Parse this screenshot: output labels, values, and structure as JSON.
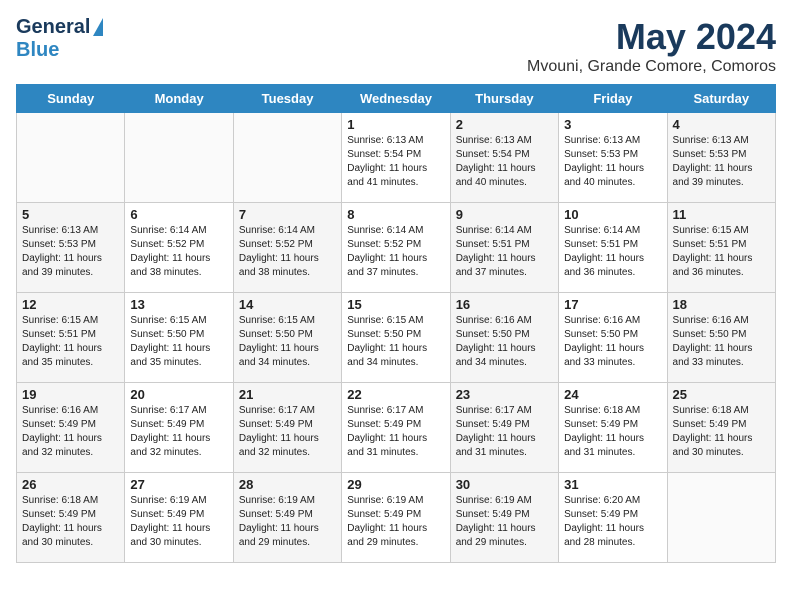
{
  "header": {
    "logo_line1": "General",
    "logo_line2": "Blue",
    "month": "May 2024",
    "location": "Mvouni, Grande Comore, Comoros"
  },
  "days_of_week": [
    "Sunday",
    "Monday",
    "Tuesday",
    "Wednesday",
    "Thursday",
    "Friday",
    "Saturday"
  ],
  "weeks": [
    [
      {
        "day": "",
        "info": ""
      },
      {
        "day": "",
        "info": ""
      },
      {
        "day": "",
        "info": ""
      },
      {
        "day": "1",
        "info": "Sunrise: 6:13 AM\nSunset: 5:54 PM\nDaylight: 11 hours and 41 minutes."
      },
      {
        "day": "2",
        "info": "Sunrise: 6:13 AM\nSunset: 5:54 PM\nDaylight: 11 hours and 40 minutes."
      },
      {
        "day": "3",
        "info": "Sunrise: 6:13 AM\nSunset: 5:53 PM\nDaylight: 11 hours and 40 minutes."
      },
      {
        "day": "4",
        "info": "Sunrise: 6:13 AM\nSunset: 5:53 PM\nDaylight: 11 hours and 39 minutes."
      }
    ],
    [
      {
        "day": "5",
        "info": "Sunrise: 6:13 AM\nSunset: 5:53 PM\nDaylight: 11 hours and 39 minutes."
      },
      {
        "day": "6",
        "info": "Sunrise: 6:14 AM\nSunset: 5:52 PM\nDaylight: 11 hours and 38 minutes."
      },
      {
        "day": "7",
        "info": "Sunrise: 6:14 AM\nSunset: 5:52 PM\nDaylight: 11 hours and 38 minutes."
      },
      {
        "day": "8",
        "info": "Sunrise: 6:14 AM\nSunset: 5:52 PM\nDaylight: 11 hours and 37 minutes."
      },
      {
        "day": "9",
        "info": "Sunrise: 6:14 AM\nSunset: 5:51 PM\nDaylight: 11 hours and 37 minutes."
      },
      {
        "day": "10",
        "info": "Sunrise: 6:14 AM\nSunset: 5:51 PM\nDaylight: 11 hours and 36 minutes."
      },
      {
        "day": "11",
        "info": "Sunrise: 6:15 AM\nSunset: 5:51 PM\nDaylight: 11 hours and 36 minutes."
      }
    ],
    [
      {
        "day": "12",
        "info": "Sunrise: 6:15 AM\nSunset: 5:51 PM\nDaylight: 11 hours and 35 minutes."
      },
      {
        "day": "13",
        "info": "Sunrise: 6:15 AM\nSunset: 5:50 PM\nDaylight: 11 hours and 35 minutes."
      },
      {
        "day": "14",
        "info": "Sunrise: 6:15 AM\nSunset: 5:50 PM\nDaylight: 11 hours and 34 minutes."
      },
      {
        "day": "15",
        "info": "Sunrise: 6:15 AM\nSunset: 5:50 PM\nDaylight: 11 hours and 34 minutes."
      },
      {
        "day": "16",
        "info": "Sunrise: 6:16 AM\nSunset: 5:50 PM\nDaylight: 11 hours and 34 minutes."
      },
      {
        "day": "17",
        "info": "Sunrise: 6:16 AM\nSunset: 5:50 PM\nDaylight: 11 hours and 33 minutes."
      },
      {
        "day": "18",
        "info": "Sunrise: 6:16 AM\nSunset: 5:50 PM\nDaylight: 11 hours and 33 minutes."
      }
    ],
    [
      {
        "day": "19",
        "info": "Sunrise: 6:16 AM\nSunset: 5:49 PM\nDaylight: 11 hours and 32 minutes."
      },
      {
        "day": "20",
        "info": "Sunrise: 6:17 AM\nSunset: 5:49 PM\nDaylight: 11 hours and 32 minutes."
      },
      {
        "day": "21",
        "info": "Sunrise: 6:17 AM\nSunset: 5:49 PM\nDaylight: 11 hours and 32 minutes."
      },
      {
        "day": "22",
        "info": "Sunrise: 6:17 AM\nSunset: 5:49 PM\nDaylight: 11 hours and 31 minutes."
      },
      {
        "day": "23",
        "info": "Sunrise: 6:17 AM\nSunset: 5:49 PM\nDaylight: 11 hours and 31 minutes."
      },
      {
        "day": "24",
        "info": "Sunrise: 6:18 AM\nSunset: 5:49 PM\nDaylight: 11 hours and 31 minutes."
      },
      {
        "day": "25",
        "info": "Sunrise: 6:18 AM\nSunset: 5:49 PM\nDaylight: 11 hours and 30 minutes."
      }
    ],
    [
      {
        "day": "26",
        "info": "Sunrise: 6:18 AM\nSunset: 5:49 PM\nDaylight: 11 hours and 30 minutes."
      },
      {
        "day": "27",
        "info": "Sunrise: 6:19 AM\nSunset: 5:49 PM\nDaylight: 11 hours and 30 minutes."
      },
      {
        "day": "28",
        "info": "Sunrise: 6:19 AM\nSunset: 5:49 PM\nDaylight: 11 hours and 29 minutes."
      },
      {
        "day": "29",
        "info": "Sunrise: 6:19 AM\nSunset: 5:49 PM\nDaylight: 11 hours and 29 minutes."
      },
      {
        "day": "30",
        "info": "Sunrise: 6:19 AM\nSunset: 5:49 PM\nDaylight: 11 hours and 29 minutes."
      },
      {
        "day": "31",
        "info": "Sunrise: 6:20 AM\nSunset: 5:49 PM\nDaylight: 11 hours and 28 minutes."
      },
      {
        "day": "",
        "info": ""
      }
    ]
  ]
}
